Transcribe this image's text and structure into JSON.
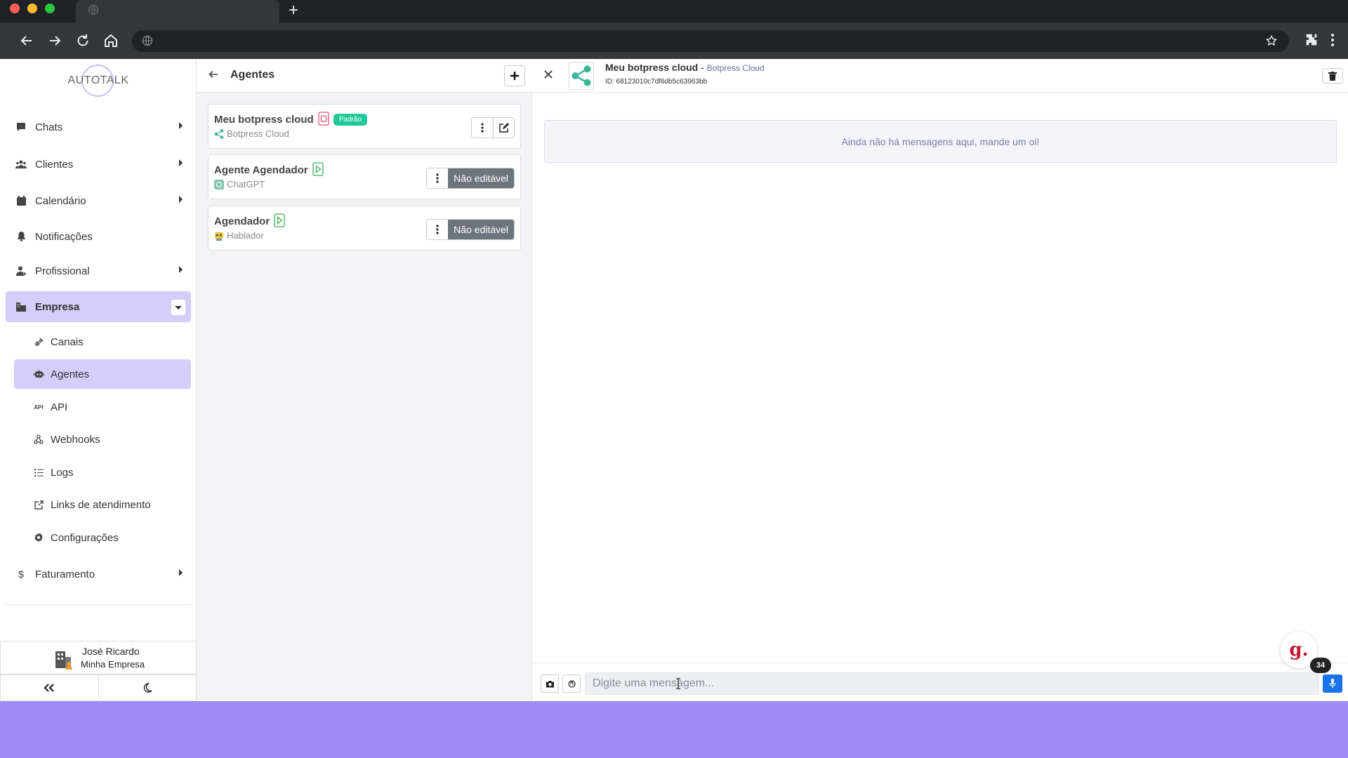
{
  "sidebar": {
    "logo_text": "AUTOTALK",
    "items": [
      {
        "label": "Chats"
      },
      {
        "label": "Clientes"
      },
      {
        "label": "Calendário"
      },
      {
        "label": "Notificações"
      },
      {
        "label": "Profissional"
      },
      {
        "label": "Empresa"
      },
      {
        "label": "Faturamento"
      }
    ],
    "subitems": [
      {
        "label": "Canais"
      },
      {
        "label": "Agentes"
      },
      {
        "label": "API"
      },
      {
        "label": "Webhooks"
      },
      {
        "label": "Logs"
      },
      {
        "label": "Links de atendimento"
      },
      {
        "label": "Configurações"
      }
    ],
    "user": {
      "name": "José Ricardo",
      "company": "Minha Empresa"
    }
  },
  "agents_panel": {
    "title": "Agentes",
    "agents": [
      {
        "name": "Meu botpress cloud",
        "provider": "Botpress Cloud",
        "badge": "Padrão",
        "status": "stopped"
      },
      {
        "name": "Agente Agendador",
        "provider": "ChatGPT",
        "action_label": "Não editável",
        "status": "running"
      },
      {
        "name": "Agendador",
        "provider": "Hablador",
        "action_label": "Não editável",
        "status": "running"
      }
    ]
  },
  "chat": {
    "title": "Meu botpress cloud",
    "separator": " - ",
    "subtitle": "Botpress Cloud",
    "id_line": "ID: 68123010c7df6db5c63963bb",
    "empty_message": "Ainda não há mensagens aqui, mande um oi!",
    "input_placeholder": "Digite uma mensagem...",
    "input_value": ""
  },
  "widget": {
    "logo": "g.",
    "count": "34"
  },
  "colors": {
    "accent": "#d5cdfa",
    "footer": "#a08cf8",
    "badge": "#20c997",
    "not_editable": "#6c757d",
    "mic": "#1a73e8"
  }
}
